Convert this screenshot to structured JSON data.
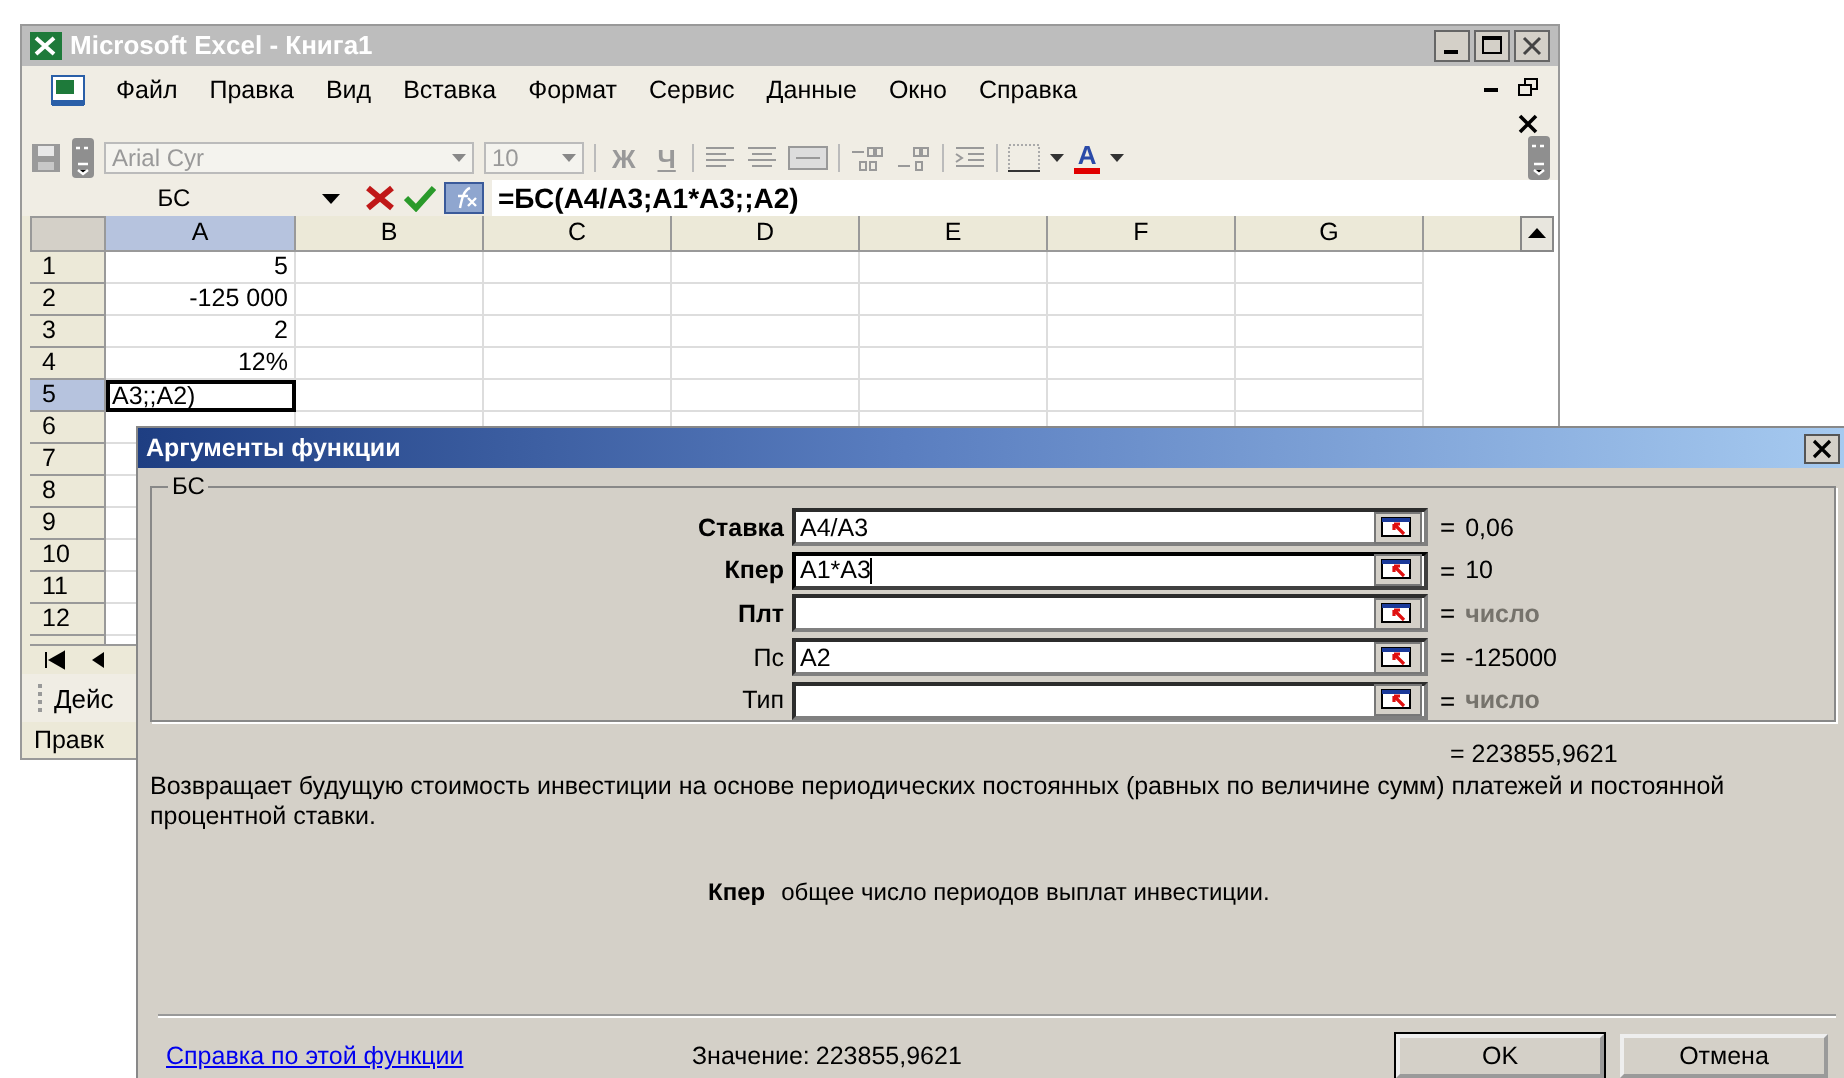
{
  "excel": {
    "title": "Microsoft Excel - Книга1",
    "menu": [
      {
        "label": "Файл"
      },
      {
        "label": "Правка"
      },
      {
        "label": "Вид"
      },
      {
        "label": "Вставка"
      },
      {
        "label": "Формат"
      },
      {
        "label": "Сервис"
      },
      {
        "label": "Данные"
      },
      {
        "label": "Окно"
      },
      {
        "label": "Справка"
      }
    ],
    "toolbar": {
      "font": "Arial Cyr",
      "size": "10",
      "bold": "Ж",
      "underline": "Ч",
      "font_color": "A"
    },
    "name_box": "БС",
    "formula": "=БС(A4/A3;A1*A3;;A2)",
    "columns": [
      {
        "label": "A",
        "selected": true
      },
      {
        "label": "B",
        "selected": false
      },
      {
        "label": "C",
        "selected": false
      },
      {
        "label": "D",
        "selected": false
      },
      {
        "label": "E",
        "selected": false
      },
      {
        "label": "F",
        "selected": false
      },
      {
        "label": "G",
        "selected": false
      }
    ],
    "rows": [
      {
        "number": "1",
        "selected": false,
        "value": "5",
        "editing": false
      },
      {
        "number": "2",
        "selected": false,
        "value": "-125 000",
        "editing": false
      },
      {
        "number": "3",
        "selected": false,
        "value": "2",
        "editing": false
      },
      {
        "number": "4",
        "selected": false,
        "value": "12%",
        "editing": false
      },
      {
        "number": "5",
        "selected": true,
        "value": "A3;;A2)",
        "editing": true
      },
      {
        "number": "6",
        "selected": false,
        "editing": false
      },
      {
        "number": "7",
        "selected": false,
        "editing": false
      },
      {
        "number": "8",
        "selected": false,
        "editing": false
      },
      {
        "number": "9",
        "selected": false,
        "editing": false
      },
      {
        "number": "10",
        "selected": false,
        "editing": false
      },
      {
        "number": "11",
        "selected": false,
        "editing": false
      },
      {
        "number": "12",
        "selected": false,
        "editing": false
      }
    ],
    "drawing_toolbar": "Дейс",
    "status": "Правк"
  },
  "dialog": {
    "title": "Аргументы функции",
    "group": "БС",
    "args": [
      {
        "label": "Ставка",
        "required": true,
        "value": "A4/A3",
        "focused": false,
        "equals": "=",
        "result": "0,06",
        "muted": false
      },
      {
        "label": "Кпер",
        "required": true,
        "value": "A1*A3",
        "focused": true,
        "equals": "=",
        "result": "10",
        "muted": false
      },
      {
        "label": "Плт",
        "required": true,
        "focused": false,
        "equals": "=",
        "result": "число",
        "muted": true
      },
      {
        "label": "Пс",
        "required": false,
        "value": "A2",
        "focused": false,
        "equals": "=",
        "result": "-125000",
        "muted": false
      },
      {
        "label": "Тип",
        "required": false,
        "focused": false,
        "equals": "=",
        "result": "число",
        "muted": true
      }
    ],
    "total": "= 223855,9621",
    "description": "Возвращает будущую стоимость инвестиции на основе периодических постоянных (равных по величине сумм) платежей и постоянной процентной ставки.",
    "help_name": "Кпер",
    "help_text": "общее число периодов выплат инвестиции.",
    "link": "Справка по этой функции",
    "value_label": "Значение:",
    "value": "223855,9621",
    "buttons": [
      {
        "label": "OK",
        "default": true
      },
      {
        "label": "Отмена",
        "default": false
      }
    ]
  }
}
